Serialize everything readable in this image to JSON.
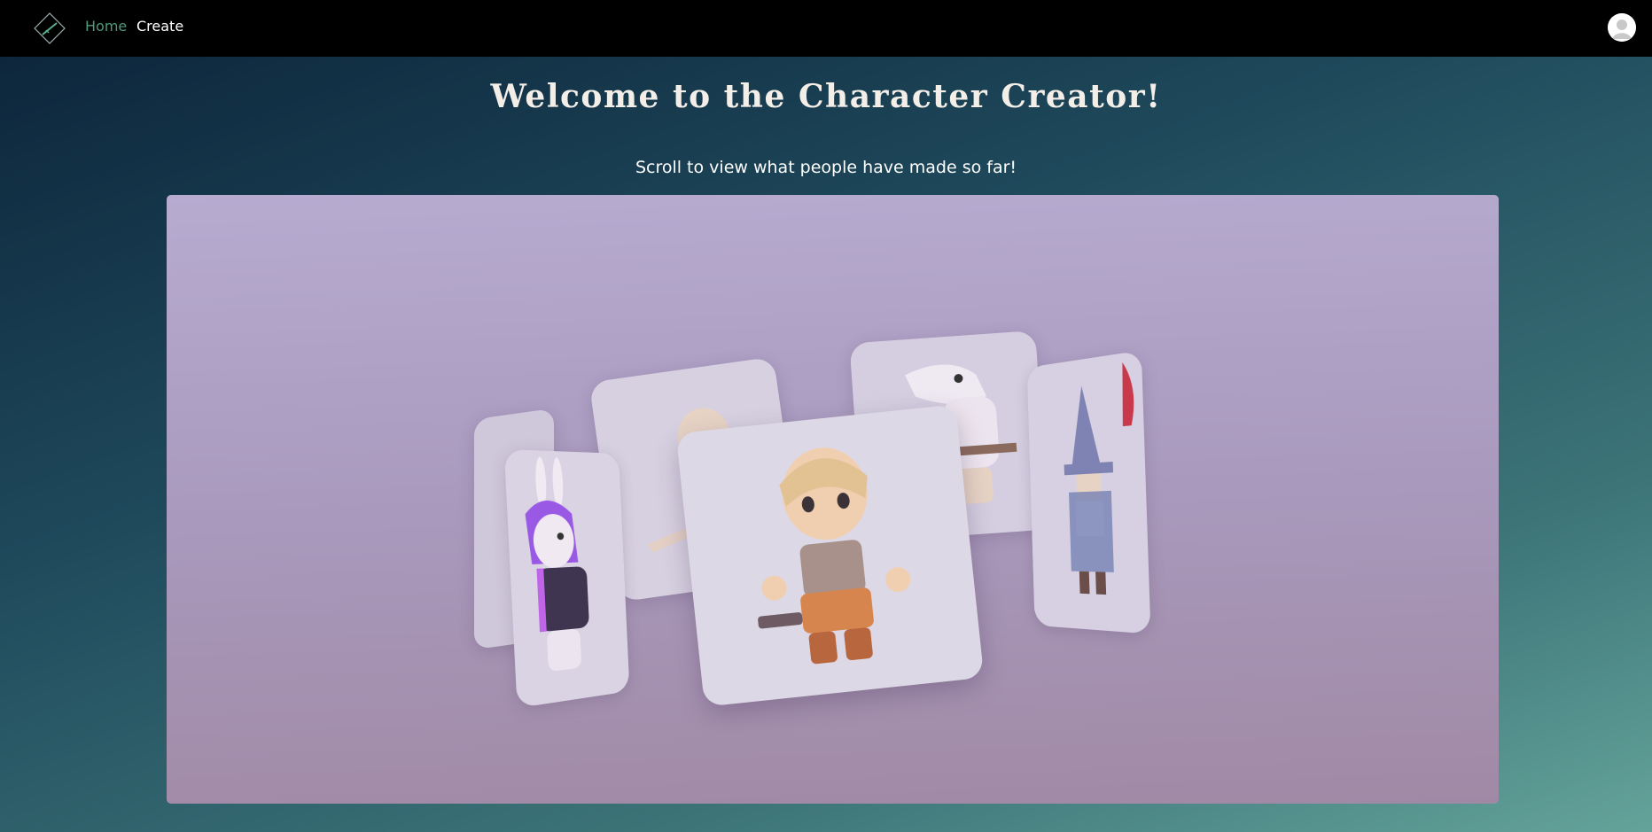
{
  "nav": {
    "logo": "sword-diamond-logo",
    "links": [
      {
        "label": "Home",
        "color": "#4e9b7a"
      },
      {
        "label": "Create",
        "color": "#ffffff"
      }
    ],
    "avatar_icon": "user-avatar-icon"
  },
  "hero": {
    "title": "Welcome to the Character Creator!",
    "subtitle": "Scroll to view what people have made so far!"
  },
  "gallery": {
    "cards": [
      {
        "character": "purple-haired bunny"
      },
      {
        "character": "bald warrior with sword"
      },
      {
        "character": "shark creature with axe"
      },
      {
        "character": "wizard with pointed hat"
      },
      {
        "character": "blonde barbarian with hammer"
      }
    ]
  }
}
